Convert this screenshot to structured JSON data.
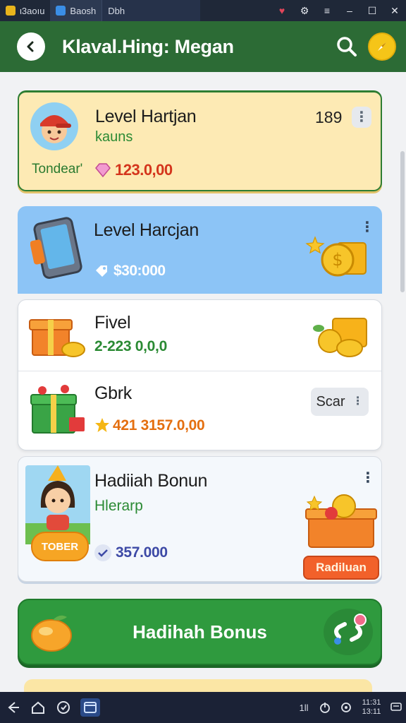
{
  "window": {
    "tabs": [
      {
        "label": "ι3aoıu",
        "active": false,
        "icon": "app-yellow-icon",
        "color": "#e8b41c"
      },
      {
        "label": "Baosh",
        "active": true,
        "icon": "app-blue-icon",
        "color": "#3a8ee6"
      },
      {
        "label": "Dbh",
        "active": false
      }
    ],
    "controls": [
      "heart-icon",
      "gear-icon",
      "menu-icon",
      "minimize-icon",
      "maximize-icon",
      "close-icon"
    ]
  },
  "header": {
    "title": "Klaval.Hing: Megan",
    "back_icon": "chevron-left-icon",
    "search_icon": "search-icon",
    "compass_icon": "compass-icon"
  },
  "cards": {
    "c1": {
      "title": "Level Hartjan",
      "subtitle": "kauns",
      "tag": "Tondear'",
      "price": "123.0,00",
      "count": "189"
    },
    "c2": {
      "title": "Level Harcjan",
      "price": "$30:000"
    },
    "c3a": {
      "title": "Fivel",
      "price": "2-223 0,0,0"
    },
    "c3b": {
      "title": "Gbrk",
      "price": "421 3157.0,00",
      "button": "Scar"
    },
    "c4": {
      "title": "Hadiiah Bonun",
      "subtitle": "Hlerarp",
      "price": "357.000",
      "badge": "Radiluan",
      "ribbon": "TOBER"
    },
    "c5": {
      "label": "Hadihah Bonus"
    }
  },
  "taskbar": {
    "left": [
      "back-icon",
      "home-icon",
      "clock-icon",
      "window-icon"
    ],
    "right_status": "1ll",
    "time_top": "11:31",
    "time_bottom": "13:11"
  }
}
